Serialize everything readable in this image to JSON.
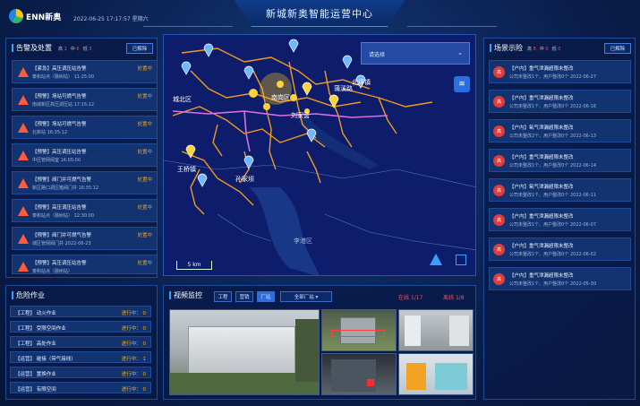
{
  "header": {
    "logo_text": "ENN新奥",
    "datetime": "2022-06-25 17:17:57 星期六",
    "title": "新城新奥智能运营中心"
  },
  "alarm_panel": {
    "title": "告警及处置",
    "counts": [
      {
        "label": "高",
        "value": "1"
      },
      {
        "label": "中",
        "value": "6"
      },
      {
        "label": "低",
        "value": "3"
      }
    ],
    "button": "已解除",
    "items": [
      {
        "type": "【紧急】",
        "name": "高压调压站告警",
        "detail": "泰和站点（融树站）  11:25:00",
        "status": "处置中"
      },
      {
        "type": "【预警】",
        "name": "场站可燃气告警",
        "detail": "南城新区高压调压站  17:15:12",
        "status": "处置中"
      },
      {
        "type": "【预警】",
        "name": "场站可燃气告警",
        "detail": "北新站  16:35:12",
        "status": "处置中"
      },
      {
        "type": "【预警】",
        "name": "高压调压站告警",
        "detail": "中压管网阀室  16:05:00",
        "status": "处置中"
      },
      {
        "type": "【预警】",
        "name": "阀门井可燃气告警",
        "detail": "新区路口调压箱阀门井  16:35:12",
        "status": "处置中"
      },
      {
        "type": "【预警】",
        "name": "高压调压站告警",
        "detail": "泰和站点（融树站）  12:30:00",
        "status": "处置中"
      },
      {
        "type": "【预警】",
        "name": "阀门井可燃气告警",
        "detail": "城区管网阀门井  2022-06-23",
        "status": "处置中"
      },
      {
        "type": "【预警】",
        "name": "高压调压站告警",
        "detail": "泰和站点（融树站）",
        "status": "处置中"
      }
    ]
  },
  "danger_panel": {
    "title": "危险作业",
    "items": [
      {
        "name": "【工程】  动火作业",
        "status": "进行中： 0"
      },
      {
        "name": "【工程】  受限空间作业",
        "status": "进行中： 0"
      },
      {
        "name": "【工程】  高处作业",
        "status": "进行中： 0"
      },
      {
        "name": "【运营】  碰接（带气接线）",
        "status": "进行中： 1"
      },
      {
        "name": "【运营】  置换作业",
        "status": "进行中： 0"
      },
      {
        "name": "【运营】  有限空间",
        "status": "进行中： 0"
      }
    ]
  },
  "map": {
    "select_placeholder": "请选择",
    "scale_label": "5 km",
    "labels": [
      {
        "text": "王桥镇"
      },
      {
        "text": "孙家坝"
      },
      {
        "text": "刘家营"
      },
      {
        "text": "蒲溪路"
      },
      {
        "text": "南岗区"
      },
      {
        "text": "李港区"
      },
      {
        "text": "北坪镇"
      },
      {
        "text": "城北区"
      }
    ]
  },
  "video_panel": {
    "title": "视频监控",
    "tabs": [
      "工程",
      "营销",
      "厂站"
    ],
    "active_tab": 2,
    "dropdown": "全部厂站 ▾",
    "stats": [
      {
        "label": "在线",
        "value": "1/17"
      },
      {
        "label": "离线",
        "value": "1/8"
      }
    ]
  },
  "scene_panel": {
    "title": "场景示险",
    "counts": [
      {
        "label": "高",
        "value": "8"
      },
      {
        "label": "中",
        "value": "0"
      },
      {
        "label": "低",
        "value": "0"
      }
    ],
    "button": "已解除",
    "badge": "高",
    "items": [
      {
        "name": "【户内】重气泄漏超限未整改",
        "detail": "公司未整改1个、用户整改0个  2022-06-27"
      },
      {
        "name": "【户内】重气泄漏超限未整改",
        "detail": "公司未整改1个、用户整改0个  2022-06-16"
      },
      {
        "name": "【户内】氧气泄漏超限未整改",
        "detail": "公司未整改2个、用户整改0个  2022-06-13"
      },
      {
        "name": "【户内】重气泄漏超限未整改",
        "detail": "公司未整改1个、用户整改0个  2022-06-14"
      },
      {
        "name": "【户内】氧气泄漏超限未整改",
        "detail": "公司未整改1个、用户整改0个  2022-06-11"
      },
      {
        "name": "【户内】重气泄漏超限未整改",
        "detail": "公司未整改1个、用户整改0个  2022-06-07"
      },
      {
        "name": "【户内】重气泄漏超限未整改",
        "detail": "公司未整改1个、用户整改0个  2022-06-02"
      },
      {
        "name": "【户内】重气泄漏超限未整改",
        "detail": "公司未整改1个、用户整改0个  2022-05-30"
      }
    ]
  },
  "colors": {
    "accent": "#3aa0ff",
    "danger": "#ff4b4b",
    "warning": "#f0a020"
  }
}
